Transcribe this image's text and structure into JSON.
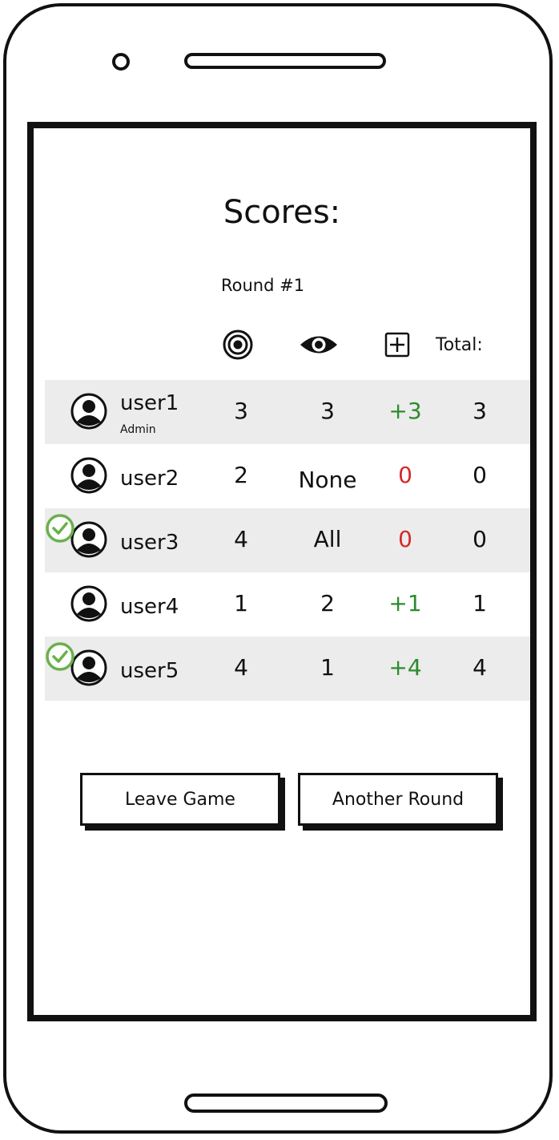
{
  "screen": {
    "title": "Scores:",
    "round_label": "Round #1"
  },
  "header": {
    "icons": [
      "target-icon",
      "eye-icon",
      "plus-square-icon"
    ],
    "total_label": "Total:"
  },
  "rows": [
    {
      "user": "user1",
      "role": "Admin",
      "ready": false,
      "score": "3",
      "seen": "3",
      "delta": "+3",
      "total": "3"
    },
    {
      "user": "user2",
      "role": "",
      "ready": false,
      "score": "2",
      "seen": "None",
      "delta": "0",
      "total": "0"
    },
    {
      "user": "user3",
      "role": "",
      "ready": true,
      "score": "4",
      "seen": "All",
      "delta": "0",
      "total": "0"
    },
    {
      "user": "user4",
      "role": "",
      "ready": false,
      "score": "1",
      "seen": "2",
      "delta": "+1",
      "total": "1"
    },
    {
      "user": "user5",
      "role": "",
      "ready": true,
      "score": "4",
      "seen": "1",
      "delta": "+4",
      "total": "4"
    }
  ],
  "buttons": {
    "leave": "Leave Game",
    "again": "Another Round"
  },
  "colors": {
    "row_shade": "#ececec",
    "positive": "#2e8b2e",
    "zero": "#d42a2a",
    "check": "#6ab04c"
  }
}
